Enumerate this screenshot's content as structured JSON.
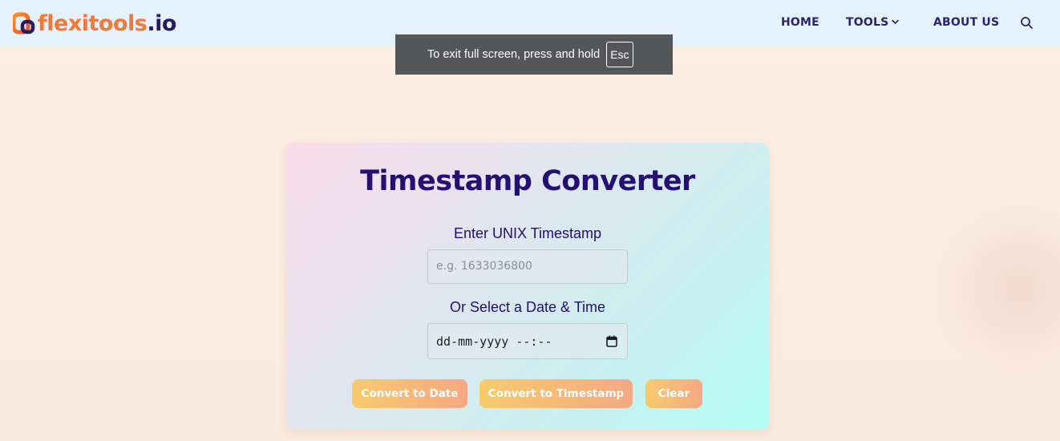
{
  "logo": {
    "brand": "flexitools",
    "tld": ".io",
    "icon": "flexitools-logo-icon"
  },
  "nav": {
    "items": [
      {
        "label": "HOME"
      },
      {
        "label": "TOOLS"
      },
      {
        "label": "ABOUT US"
      }
    ],
    "tools_icon": "chevron-down-icon",
    "search_icon": "search-icon"
  },
  "fullscreen_notice": {
    "text": "To exit full screen, press and hold",
    "key": "Esc"
  },
  "converter": {
    "title": "Timestamp Converter",
    "unix_label": "Enter UNIX Timestamp",
    "unix_placeholder": "e.g. 1633036800",
    "date_label": "Or Select a Date & Time",
    "date_value": "dd-mm-yyyy --:--",
    "date_icon": "calendar-icon",
    "buttons": {
      "to_date": "Convert to Date",
      "to_timestamp": "Convert to Timestamp",
      "clear": "Clear"
    }
  },
  "colors": {
    "accent_orange": "#f07a3a",
    "nav_text": "#2b2270",
    "title": "#250f72",
    "button_from": "#f7cb6c",
    "button_to": "#f6a883"
  }
}
